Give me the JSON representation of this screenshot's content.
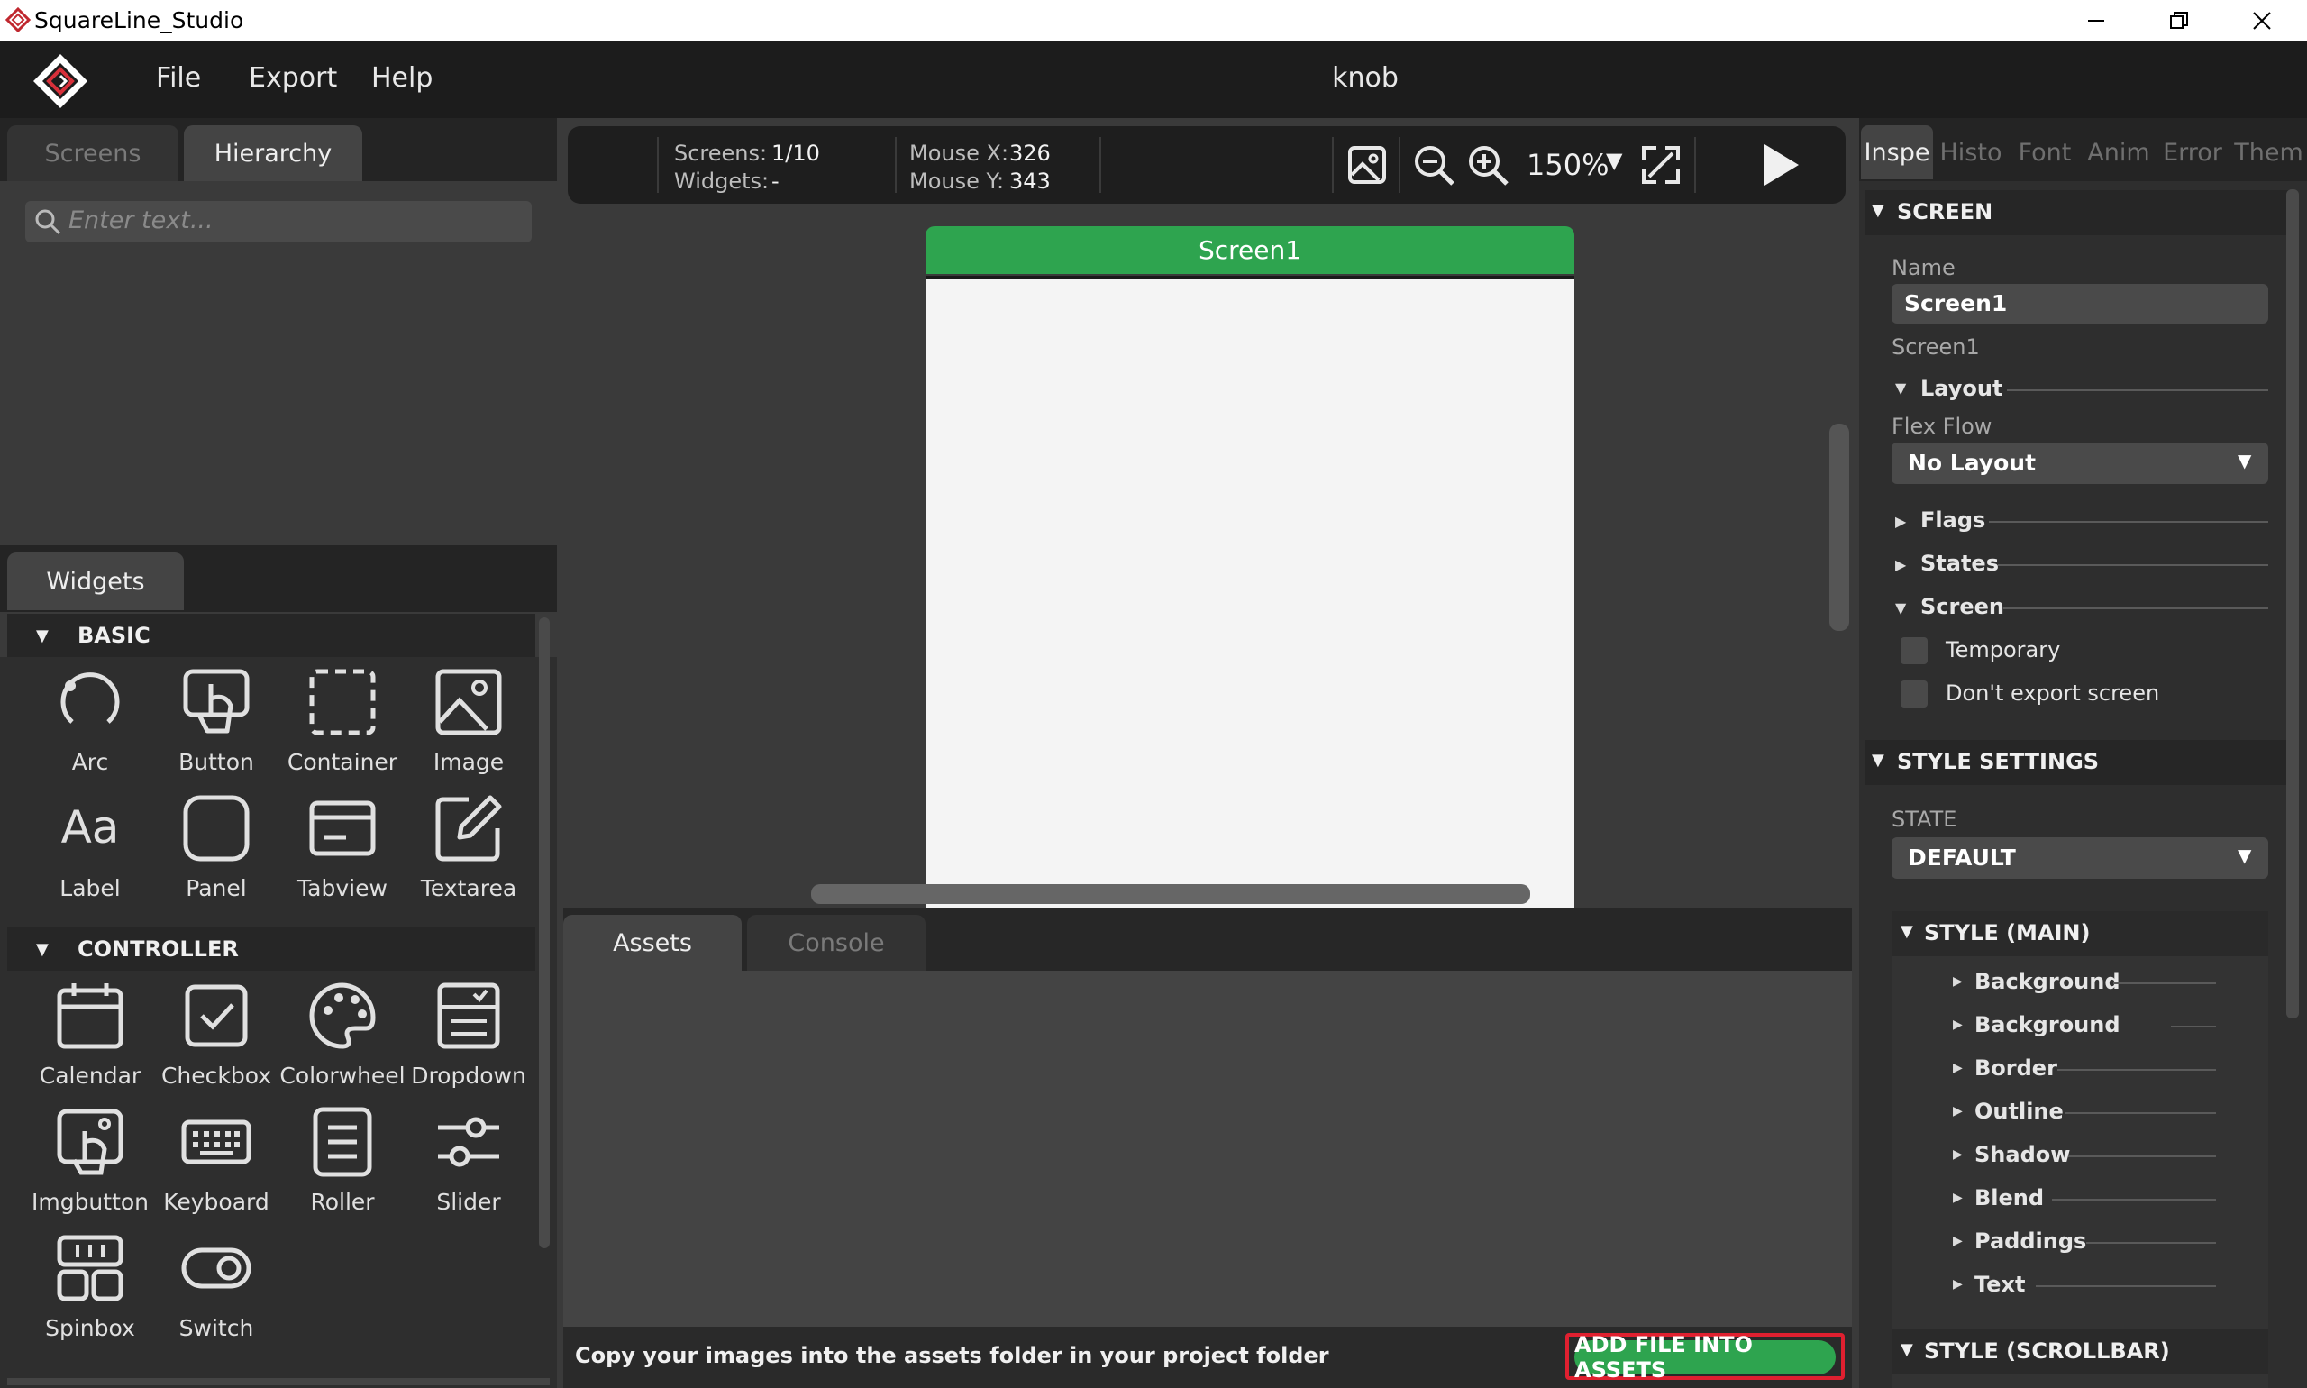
{
  "window": {
    "title": "SquareLine_Studio"
  },
  "menu": {
    "items": [
      "File",
      "Export",
      "Help"
    ],
    "project_title": "knob"
  },
  "left": {
    "tabs": [
      "Screens",
      "Hierarchy"
    ],
    "search_placeholder": "Enter text...",
    "widgets_tab": "Widgets",
    "sections": [
      {
        "title": "BASIC",
        "items": [
          "Arc",
          "Button",
          "Container",
          "Image",
          "Label",
          "Panel",
          "Tabview",
          "Textarea"
        ]
      },
      {
        "title": "CONTROLLER",
        "items": [
          "Calendar",
          "Checkbox",
          "Colorwheel",
          "Dropdown",
          "Imgbutton",
          "Keyboard",
          "Roller",
          "Slider",
          "Spinbox",
          "Switch"
        ]
      }
    ]
  },
  "toolbar": {
    "screens_label": "Screens:",
    "screens_value": "1/10",
    "widgets_label": "Widgets:",
    "widgets_value": "-",
    "mouse_x_label": "Mouse X:",
    "mouse_x_value": "326",
    "mouse_y_label": "Mouse Y:",
    "mouse_y_value": "343",
    "zoom": "150%"
  },
  "canvas": {
    "screen_name": "Screen1"
  },
  "bottom": {
    "tabs": [
      "Assets",
      "Console"
    ],
    "hint": "Copy your images into the assets folder in your project folder",
    "add_button": "ADD FILE INTO ASSETS"
  },
  "inspector": {
    "tabs": [
      "Inspe",
      "Histo",
      "Font",
      "Anim",
      "Error",
      "Them"
    ],
    "screen_section": "SCREEN",
    "name_label": "Name",
    "name_value": "Screen1",
    "screen_type": "Screen1",
    "layout_label": "Layout",
    "flex_flow_label": "Flex Flow",
    "flex_flow_value": "No Layout",
    "flags_label": "Flags",
    "states_label": "States",
    "screen_group_label": "Screen",
    "temporary_label": "Temporary",
    "dont_export_label": "Don't export screen",
    "style_settings": "STYLE SETTINGS",
    "state_label": "STATE",
    "state_value": "DEFAULT",
    "style_main": "STYLE (MAIN)",
    "style_props": [
      "Background",
      "Background",
      "Border",
      "Outline",
      "Shadow",
      "Blend",
      "Paddings",
      "Text"
    ],
    "style_scrollbar": "STYLE (SCROLLBAR)"
  },
  "colors": {
    "accent_green": "#2ea44f",
    "highlight_red": "#e02030",
    "panel_dark": "#2e2e2e"
  }
}
